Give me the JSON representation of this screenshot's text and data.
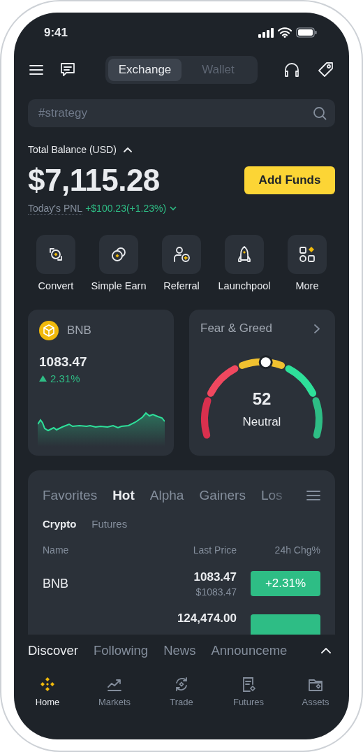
{
  "status_bar": {
    "time": "9:41"
  },
  "header": {
    "tabs": [
      {
        "label": "Exchange",
        "selected": true
      },
      {
        "label": "Wallet",
        "selected": false
      }
    ]
  },
  "search": {
    "placeholder": "#strategy"
  },
  "balance": {
    "label": "Total Balance (USD)",
    "expanded": true,
    "amount": "$7,115.28",
    "pnl_label": "Today's PNL",
    "pnl_value": "+$100.23(+1.23%)",
    "add_funds": "Add Funds"
  },
  "shortcuts": [
    {
      "label": "Convert",
      "kind": "convert"
    },
    {
      "label": "Simple Earn",
      "kind": "earn"
    },
    {
      "label": "Referral",
      "kind": "referral"
    },
    {
      "label": "Launchpool",
      "kind": "launchpool"
    },
    {
      "label": "More",
      "kind": "more"
    }
  ],
  "bnb_card": {
    "symbol": "BNB",
    "price": "1083.47",
    "change": "2.31%"
  },
  "fear_greed": {
    "title": "Fear & Greed",
    "value": "52",
    "label": "Neutral"
  },
  "market": {
    "tabs": [
      {
        "label": "Favorites",
        "selected": false
      },
      {
        "label": "Hot",
        "selected": true
      },
      {
        "label": "Alpha",
        "selected": false
      },
      {
        "label": "Gainers",
        "selected": false
      },
      {
        "label": "Los",
        "selected": false
      }
    ],
    "subtabs": [
      {
        "label": "Crypto",
        "selected": true
      },
      {
        "label": "Futures",
        "selected": false
      }
    ],
    "columns": [
      "Name",
      "Last Price",
      "24h Chg%"
    ],
    "rows": [
      {
        "name": "BNB",
        "price": "1083.47",
        "price_usd": "$1083.47",
        "change": "+2.31%"
      },
      {
        "price": "124,474.00"
      }
    ]
  },
  "feed_tabs": [
    {
      "label": "Discover",
      "selected": true
    },
    {
      "label": "Following",
      "selected": false
    },
    {
      "label": "News",
      "selected": false
    },
    {
      "label": "Announceme",
      "selected": false
    }
  ],
  "nav": [
    {
      "label": "Home",
      "kind": "home",
      "selected": true
    },
    {
      "label": "Markets",
      "kind": "markets",
      "selected": false
    },
    {
      "label": "Trade",
      "kind": "trade",
      "selected": false
    },
    {
      "label": "Futures",
      "kind": "futures",
      "selected": false
    },
    {
      "label": "Assets",
      "kind": "assets",
      "selected": false
    }
  ]
}
